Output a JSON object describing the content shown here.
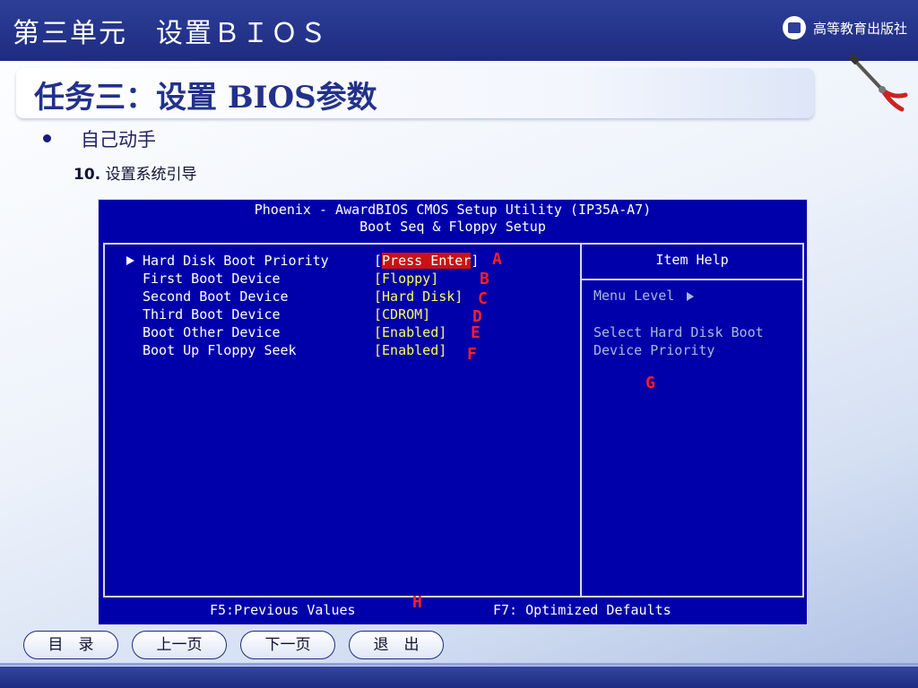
{
  "slide": {
    "banner_title": "第三单元　设置ＢＩＯＳ",
    "publisher": "高等教育出版社",
    "task_title": "任务三：设置 BIOS参数",
    "bullet": "自己动手",
    "step_number": "10.",
    "step_text": "设置系统引导"
  },
  "bios": {
    "header_line1": "Phoenix - AwardBIOS CMOS Setup Utility (IP35A-A7)",
    "header_line2": "Boot Seq & Floppy Setup",
    "items": [
      {
        "label": "Hard Disk Boot Priority",
        "value_open": "[",
        "value": "Press Enter",
        "value_close": "]",
        "annotation": "A"
      },
      {
        "label": "First Boot Device",
        "value": "[Floppy]",
        "annotation": "B"
      },
      {
        "label": "Second Boot Device",
        "value": "[Hard Disk]",
        "annotation": "C"
      },
      {
        "label": "Third Boot Device",
        "value": "[CDROM]",
        "annotation": "D"
      },
      {
        "label": "Boot Other Device",
        "value": "[Enabled]",
        "annotation": "E"
      },
      {
        "label": "Boot Up Floppy Seek",
        "value": "[Enabled]",
        "annotation": "F"
      }
    ],
    "help_title": "Item Help",
    "help_level": "Menu Level",
    "help_desc": "Select Hard Disk Boot Device Priority",
    "help_annotation": "G",
    "footer_left": "F5:Previous Values",
    "footer_annotation": "H",
    "footer_right": "F7: Optimized Defaults"
  },
  "nav": {
    "toc": "目　录",
    "prev": "上一页",
    "next": "下一页",
    "exit": "退　出"
  },
  "colors": {
    "bios_bg": "#0000aa",
    "bios_value": "#ffff55",
    "highlight": "#cc1111",
    "annotation": "#ff2020",
    "banner": "#1e2b80"
  }
}
